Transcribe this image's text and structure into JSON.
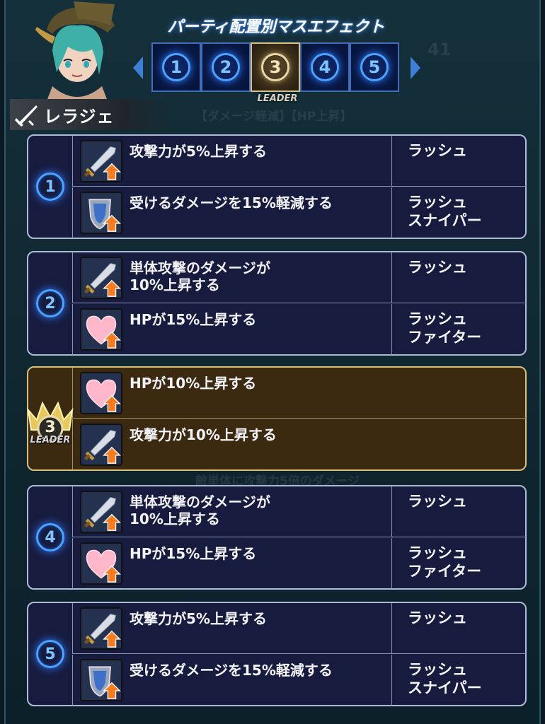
{
  "header": {
    "title": "パーティ配置別マスエフェクト",
    "leader_label": "LEADER",
    "tabs": [
      {
        "label": "1",
        "selected": false
      },
      {
        "label": "2",
        "selected": false
      },
      {
        "label": "3",
        "selected": true
      },
      {
        "label": "4",
        "selected": false
      },
      {
        "label": "5",
        "selected": false
      }
    ]
  },
  "character": {
    "name": "レラジェ"
  },
  "background_ghost": {
    "text1": "41",
    "text2": "【ダメージ軽減】【HP上昇】",
    "text3": "敵単体に攻撃力5倍のダメージ"
  },
  "slots": [
    {
      "number": "1",
      "rows": [
        {
          "icon": "sword-up-icon",
          "desc": "攻撃力が5%上昇する",
          "target": "ラッシュ"
        },
        {
          "icon": "shield-up-icon",
          "desc": "受けるダメージを15%軽減する",
          "target": "ラッシュ\nスナイパー"
        }
      ]
    },
    {
      "number": "2",
      "rows": [
        {
          "icon": "sword-up-icon",
          "desc": "単体攻撃のダメージが\n10%上昇する",
          "target": "ラッシュ"
        },
        {
          "icon": "heart-up-icon",
          "desc": "HPが15%上昇する",
          "target": "ラッシュ\nファイター"
        }
      ]
    },
    {
      "number": "3",
      "leader": true,
      "leader_label": "LEADER",
      "rows": [
        {
          "icon": "heart-up-icon",
          "desc": "HPが10%上昇する",
          "target": ""
        },
        {
          "icon": "sword-up-icon",
          "desc": "攻撃力が10%上昇する",
          "target": ""
        }
      ]
    },
    {
      "number": "4",
      "rows": [
        {
          "icon": "sword-up-icon",
          "desc": "単体攻撃のダメージが\n10%上昇する",
          "target": "ラッシュ"
        },
        {
          "icon": "heart-up-icon",
          "desc": "HPが15%上昇する",
          "target": "ラッシュ\nファイター"
        }
      ]
    },
    {
      "number": "5",
      "rows": [
        {
          "icon": "sword-up-icon",
          "desc": "攻撃力が5%上昇する",
          "target": "ラッシュ"
        },
        {
          "icon": "shield-up-icon",
          "desc": "受けるダメージを15%軽減する",
          "target": "ラッシュ\nスナイパー"
        }
      ]
    }
  ],
  "colors": {
    "slot_bg": "#171c3f",
    "leader_bg": "#3b2a10",
    "accent_blue": "#4aa3ff",
    "gold": "#d8bf7a"
  }
}
